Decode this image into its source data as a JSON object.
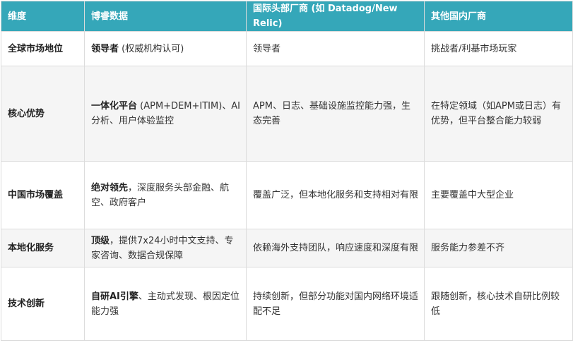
{
  "headers": [
    "维度",
    "博睿数据",
    "国际头部厂商 (如 Datadog/New Relic)",
    "其他国内厂商"
  ],
  "rows": [
    {
      "dimension": "全球市场地位",
      "borui_bold": "领导者",
      "borui_rest": " (权威机构认可)",
      "intl": "领导者",
      "domestic": "挑战者/利基市场玩家"
    },
    {
      "dimension": "核心优势",
      "borui_bold": "一体化平台",
      "borui_rest": " (APM+DEM+ITIM)、AI分析、用户体验监控",
      "intl": "APM、日志、基础设施监控能力强，生态完善",
      "domestic": "在特定领域（如APM或日志）有优势，但平台整合能力较弱"
    },
    {
      "dimension": "中国市场覆盖",
      "borui_bold": "绝对领先",
      "borui_rest": "，深度服务头部金融、航空、政府客户",
      "intl": "覆盖广泛，但本地化服务和支持相对有限",
      "domestic": "主要覆盖中大型企业"
    },
    {
      "dimension": "本地化服务",
      "borui_bold": "顶级",
      "borui_rest": "，提供7x24小时中文支持、专家咨询、数据合规保障",
      "intl": "依赖海外支持团队，响应速度和深度有限",
      "domestic": "服务能力参差不齐"
    },
    {
      "dimension": "技术创新",
      "borui_bold": "自研AI引擎",
      "borui_rest": "、主动式发现、根因定位能力强",
      "intl": "持续创新，但部分功能对国内网络环境适配不足",
      "domestic": "跟随创新，核心技术自研比例较低"
    }
  ]
}
